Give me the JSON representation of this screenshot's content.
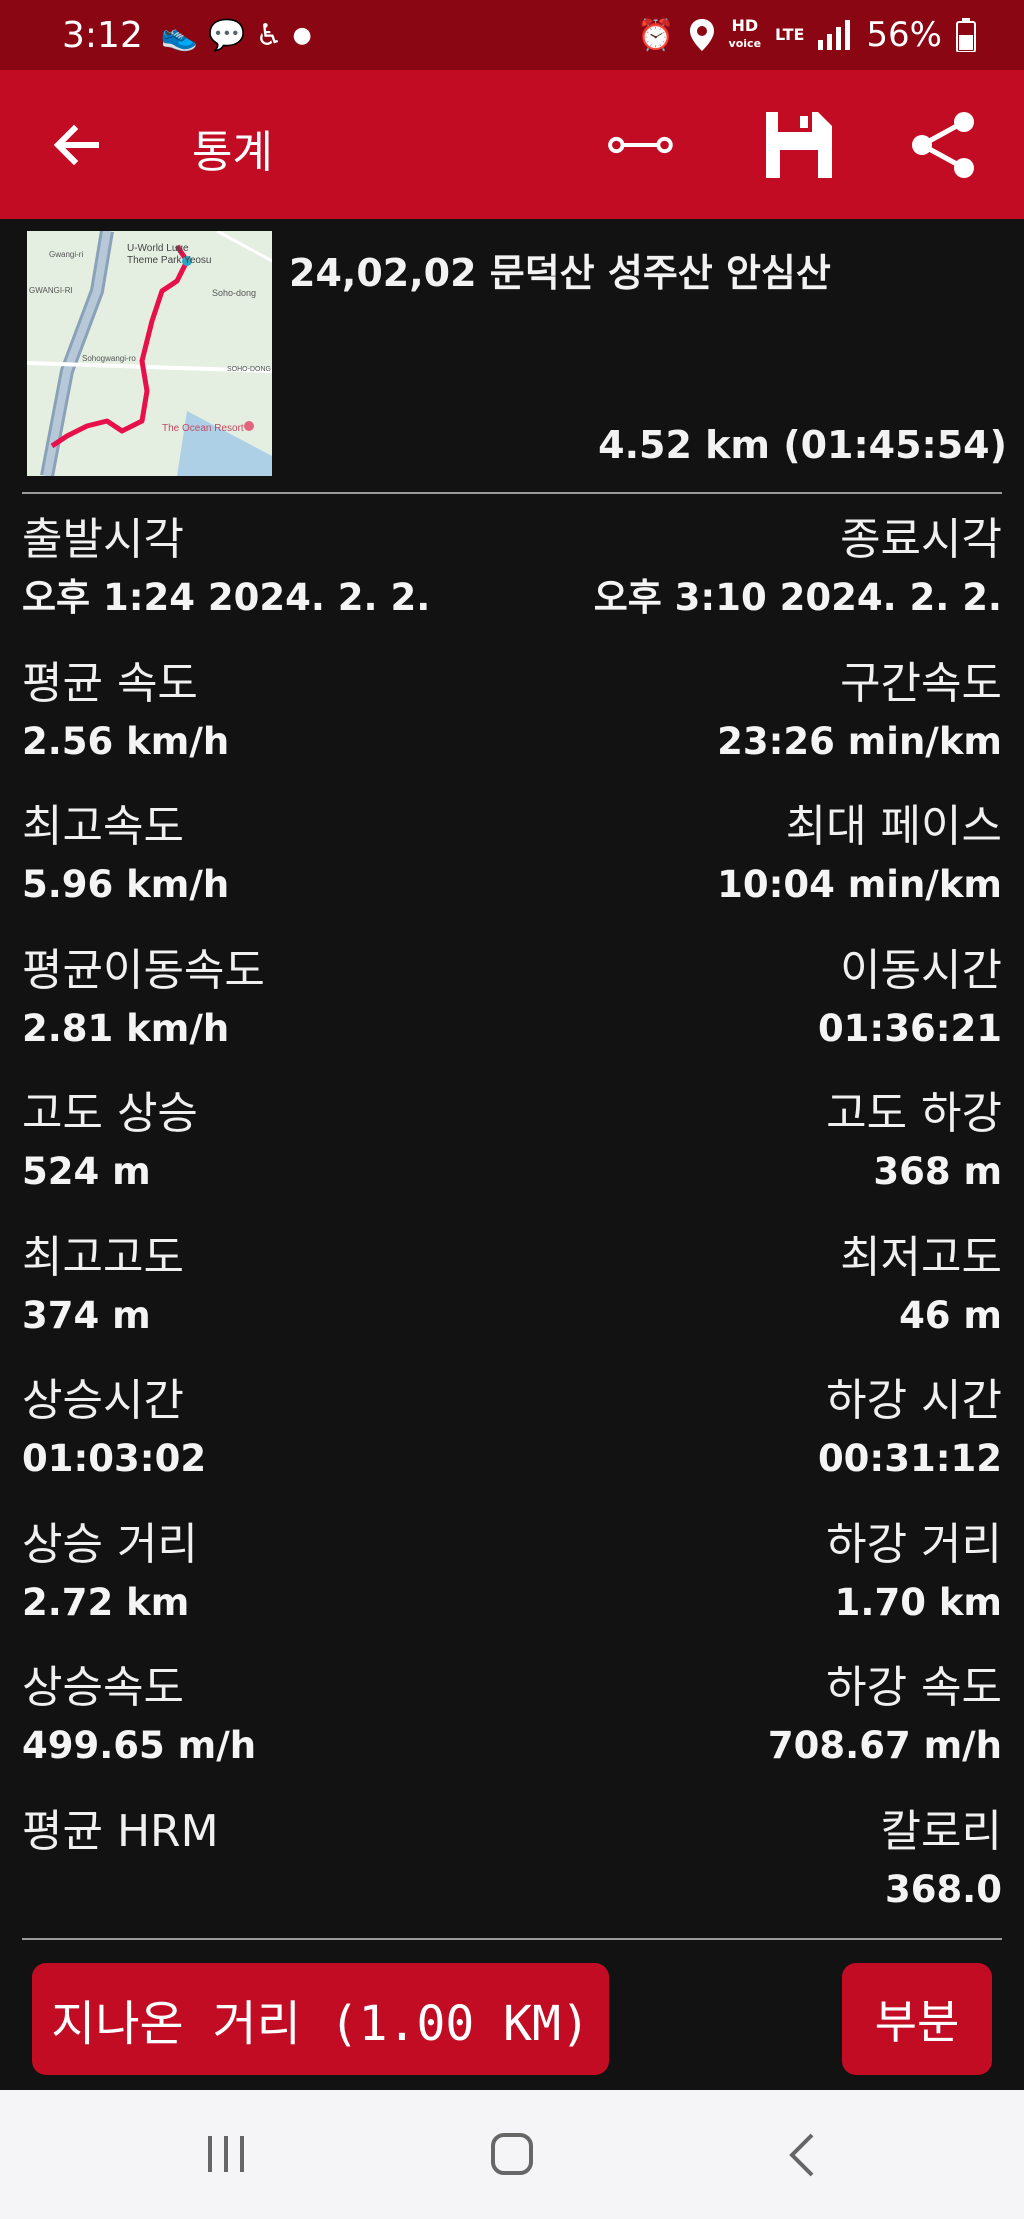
{
  "status_bar": {
    "time": "3:12",
    "network_hd": "HD",
    "network_voice": "voice",
    "network_lte": "LTE",
    "battery": "56%",
    "icons": [
      "run-notification-icon",
      "chat-notification-icon",
      "accessibility-icon",
      "dot-icon",
      "alarm-icon",
      "location-icon",
      "signal-icon",
      "battery-icon"
    ]
  },
  "app_bar": {
    "title": "통계",
    "icons": [
      "back-arrow-icon",
      "route-segment-icon",
      "save-icon",
      "share-icon"
    ]
  },
  "summary": {
    "route_name": "24,02,02 문덕산 성주산 안심산",
    "total": "4.52 km (01:45:54)",
    "map_labels": [
      "U-World Luge",
      "Theme Park Yeosu",
      "Gwangi-ri",
      "GWANGI-RI",
      "Sohogwangi-ro",
      "Soho-dong",
      "SOHO-DONG",
      "The Ocean Resort"
    ]
  },
  "stats": [
    {
      "left_label": "출발시각",
      "left_value": "오후 1:24 2024. 2. 2.",
      "right_label": "종료시각",
      "right_value": "오후 3:10 2024. 2. 2."
    },
    {
      "left_label": "평균 속도",
      "left_value": "2.56 km/h",
      "right_label": "구간속도",
      "right_value": "23:26 min/km"
    },
    {
      "left_label": "최고속도",
      "left_value": "5.96 km/h",
      "right_label": "최대 페이스",
      "right_value": "10:04 min/km"
    },
    {
      "left_label": "평균이동속도",
      "left_value": "2.81 km/h",
      "right_label": "이동시간",
      "right_value": "01:36:21"
    },
    {
      "left_label": "고도 상승",
      "left_value": "524 m",
      "right_label": "고도 하강",
      "right_value": "368 m"
    },
    {
      "left_label": "최고고도",
      "left_value": "374 m",
      "right_label": "최저고도",
      "right_value": "46 m"
    },
    {
      "left_label": "상승시간",
      "left_value": "01:03:02",
      "right_label": "하강 시간",
      "right_value": "00:31:12"
    },
    {
      "left_label": "상승 거리",
      "left_value": "2.72 km",
      "right_label": "하강 거리",
      "right_value": "1.70 km"
    },
    {
      "left_label": "상승속도",
      "left_value": "499.65 m/h",
      "right_label": "하강 속도",
      "right_value": "708.67 m/h"
    },
    {
      "left_label": "평균 HRM",
      "left_value": "",
      "right_label": "칼로리",
      "right_value": "368.0"
    }
  ],
  "buttons": {
    "distance": "지나온 거리 (1.00  KM)",
    "partial": "부분"
  },
  "colors": {
    "status_bar": "#8a0612",
    "accent": "#c20c24",
    "background": "#121212",
    "route_line": "#e8104a"
  }
}
